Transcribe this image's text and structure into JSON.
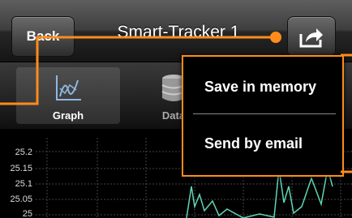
{
  "navbar": {
    "back_label": "Back",
    "title": "Smart-Tracker 1",
    "share_icon": "share-icon"
  },
  "tabs": [
    {
      "label": "Graph",
      "icon": "graph-icon",
      "selected": true
    },
    {
      "label": "Data",
      "icon": "database-icon",
      "selected": false
    }
  ],
  "menu": {
    "items": [
      {
        "label": "Save in memory"
      },
      {
        "label": "Send by email"
      }
    ]
  },
  "chart": {
    "y_ticks": [
      "25.2",
      "25.15",
      "25.1",
      "25.05",
      "25"
    ],
    "line_color": "#5fd6b6"
  },
  "colors": {
    "callout": "#ff8c1a",
    "navbar": "#2e2e2e"
  }
}
